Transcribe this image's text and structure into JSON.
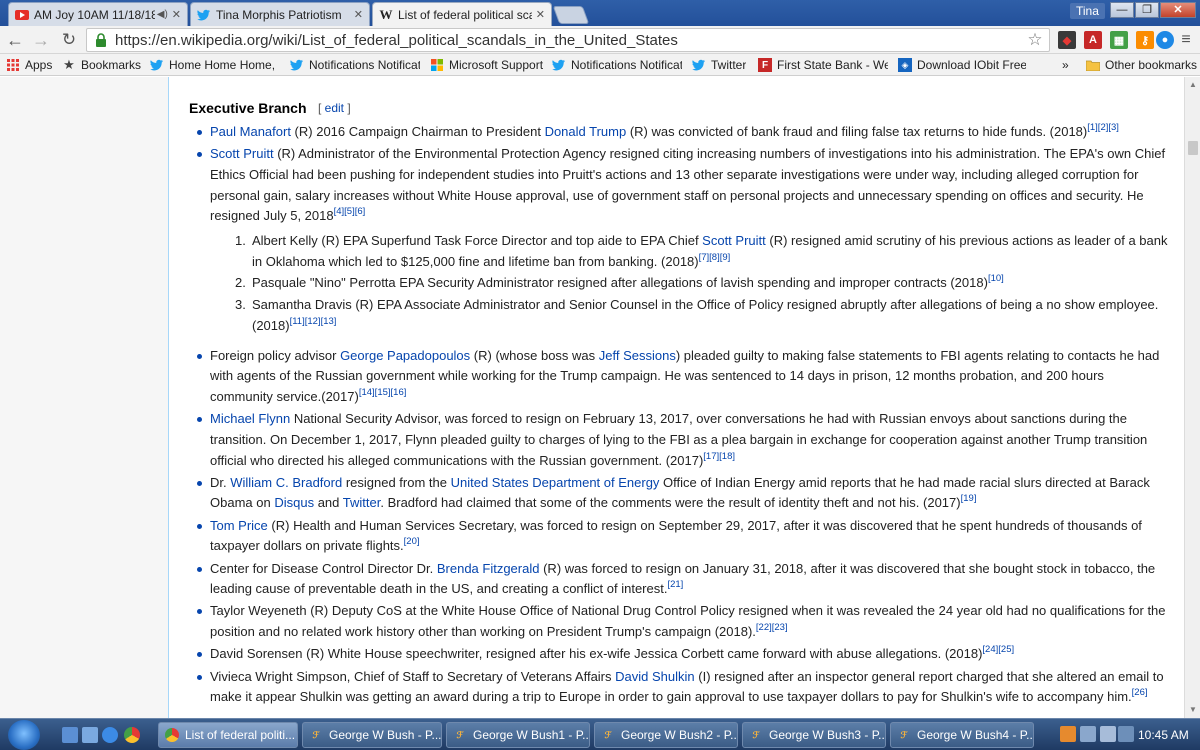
{
  "browser": {
    "tabs": [
      {
        "label": "AM Joy 10AM 11/18/18",
        "icon": "youtube-icon",
        "active": false
      },
      {
        "label": "Tina Morphis Patriotism",
        "icon": "twitter-icon",
        "active": false
      },
      {
        "label": "List of federal political sca",
        "icon": "wikipedia-icon",
        "active": true
      }
    ],
    "user": "Tina",
    "url": "https://en.wikipedia.org/wiki/List_of_federal_political_scandals_in_the_United_States",
    "colors": {
      "accent": "#2f5fa8",
      "link": "#0645ad",
      "youtube": "#e52d27",
      "twitter": "#1da1f2"
    }
  },
  "bookmarks": [
    {
      "label": "Apps",
      "icon": "apps-grid-icon"
    },
    {
      "label": "Bookmarks",
      "icon": "star-icon"
    },
    {
      "label": "Home Home Home, c",
      "icon": "twitter-icon"
    },
    {
      "label": "Notifications Notificat",
      "icon": "twitter-icon"
    },
    {
      "label": "Microsoft Support",
      "icon": "microsoft-icon"
    },
    {
      "label": "Notifications Notificat",
      "icon": "twitter-icon"
    },
    {
      "label": "Twitter",
      "icon": "twitter-icon"
    },
    {
      "label": "First State Bank - Welc",
      "icon": "bank-icon"
    },
    {
      "label": "Download IObit Freew",
      "icon": "iobit-icon"
    },
    {
      "label": "»",
      "icon": "overflow-icon"
    },
    {
      "label": "Other bookmarks",
      "icon": "folder-icon"
    }
  ],
  "article": {
    "section_title": "Executive Branch",
    "edit_open": "[ ",
    "edit_label": "edit",
    "edit_close": " ]"
  },
  "taskbar": {
    "items": [
      {
        "label": "List of federal politi...",
        "icon": "chrome-icon",
        "active": true
      },
      {
        "label": "George  W  Bush - P...",
        "icon": "photoshop-icon",
        "active": false
      },
      {
        "label": "George W Bush1 - P...",
        "icon": "photoshop-icon",
        "active": false
      },
      {
        "label": "George W Bush2 - P...",
        "icon": "photoshop-icon",
        "active": false
      },
      {
        "label": "George W Bush3 - P...",
        "icon": "photoshop-icon",
        "active": false
      },
      {
        "label": "George W Bush4 - P...",
        "icon": "photoshop-icon",
        "active": false
      }
    ],
    "clock": "10:45 AM"
  }
}
